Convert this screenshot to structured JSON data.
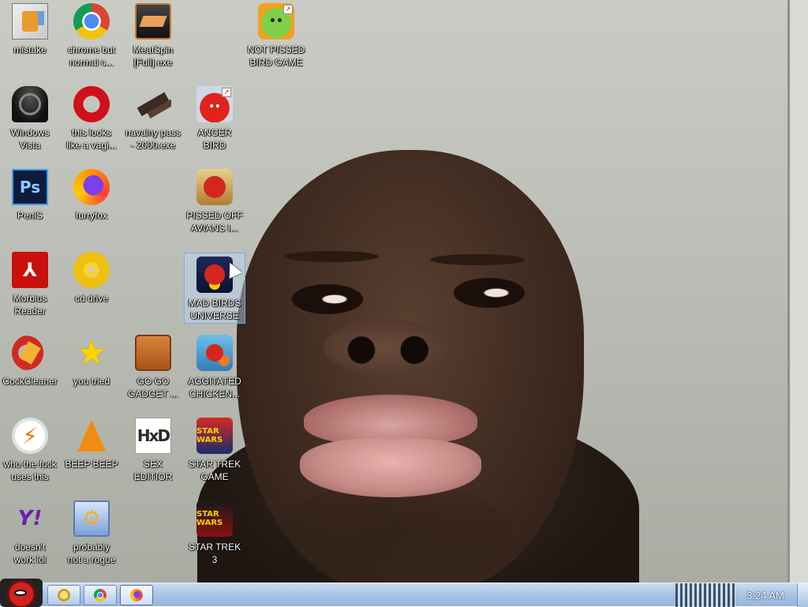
{
  "desktop": {
    "icons": [
      {
        "id": "mistake",
        "label": "mistake",
        "glyph": "g-mistake",
        "glyph_text": "",
        "icon": "installer-icon"
      },
      {
        "id": "chrome",
        "label": "chrome but\nnormal c...",
        "glyph": "g-chrome",
        "glyph_text": "",
        "icon": "chrome-icon"
      },
      {
        "id": "meatspin",
        "label": "MeatSpin\n[Full].exe",
        "glyph": "g-meat",
        "glyph_text": "",
        "icon": "app-icon"
      },
      {
        "id": "notpissed",
        "label": "NOT PISSED\nBIRD GAME",
        "glyph": "g-pig",
        "glyph_text": "",
        "icon": "green-pig-icon"
      },
      {
        "id": "vista",
        "label": "Windows\nVista",
        "glyph": "g-vista",
        "glyph_text": "",
        "icon": "trash-bin-icon"
      },
      {
        "id": "opera",
        "label": "this looks\nlike a vagi...",
        "glyph": "g-opera",
        "glyph_text": "",
        "icon": "opera-icon"
      },
      {
        "id": "navalny",
        "label": "navalny pass\n- 2000.exe",
        "glyph": "g-gun",
        "glyph_text": "",
        "icon": "pistol-icon"
      },
      {
        "id": "anger",
        "label": "ANGER\nBIRD",
        "glyph": "g-angry",
        "glyph_text": "",
        "icon": "red-bird-icon"
      },
      {
        "id": "penis",
        "label": "PeniS",
        "glyph": "g-ps",
        "glyph_text": "Ps",
        "icon": "photoshop-icon"
      },
      {
        "id": "furryfox",
        "label": "furryfox",
        "glyph": "g-ff",
        "glyph_text": "",
        "icon": "firefox-icon"
      },
      {
        "id": "avians",
        "label": "PISSED OFF\nAVIANS I...",
        "glyph": "g-seasons",
        "glyph_text": "",
        "icon": "bird-seasons-icon"
      },
      {
        "id": "morbius",
        "label": "Morbius\nReader",
        "glyph": "g-pdf",
        "glyph_text": "⅄",
        "icon": "pdf-reader-icon"
      },
      {
        "id": "cddrive",
        "label": "cd drive",
        "glyph": "g-cd",
        "glyph_text": "",
        "icon": "cd-icon"
      },
      {
        "id": "madbirds",
        "label": "MAD BIRDS\nUNIVERSE",
        "glyph": "g-space",
        "glyph_text": "",
        "icon": "bird-space-icon",
        "selected": true
      },
      {
        "id": "cockclean",
        "label": "CockCleaner",
        "glyph": "g-ccl",
        "glyph_text": "",
        "icon": "cleaner-icon"
      },
      {
        "id": "youtried",
        "label": "you tried",
        "glyph": "g-star",
        "glyph_text": "★",
        "icon": "star-icon"
      },
      {
        "id": "gadget",
        "label": "GO GO\nGADGET ...",
        "glyph": "g-case",
        "glyph_text": "",
        "icon": "briefcase-icon"
      },
      {
        "id": "chicken",
        "label": "AGGITATED\nCHICKEN...",
        "glyph": "g-chicken",
        "glyph_text": "",
        "icon": "bird-rio-icon"
      },
      {
        "id": "whofuck",
        "label": "who the fuck\nuses this",
        "glyph": "g-bolt",
        "glyph_text": "⚡",
        "icon": "lightning-icon"
      },
      {
        "id": "beepbeep",
        "label": "BEEP BEEP",
        "glyph": "g-vlc",
        "glyph_text": "",
        "icon": "traffic-cone-icon"
      },
      {
        "id": "sexedit",
        "label": "SEX\nEDITIOR",
        "glyph": "g-hxd",
        "glyph_text": "HxD",
        "icon": "hex-editor-icon"
      },
      {
        "id": "startrek",
        "label": "STAR TREK\nGAME",
        "glyph": "g-sw",
        "glyph_text": "STAR WARS",
        "icon": "bird-starwars-icon"
      },
      {
        "id": "yahoo",
        "label": "doesn't\nwork lol",
        "glyph": "g-yahoo",
        "glyph_text": "Y!",
        "icon": "yahoo-messenger-icon"
      },
      {
        "id": "rogue",
        "label": "probably\nnot a rogue",
        "glyph": "g-gears",
        "glyph_text": "",
        "icon": "control-panel-icon"
      },
      {
        "id": "startrek3",
        "label": "STAR TREK\n3",
        "glyph": "g-sw3",
        "glyph_text": "STAR WARS",
        "icon": "bird-starwars-2-icon"
      }
    ]
  },
  "taskbar": {
    "clock": "3:24 AM",
    "buttons": [
      {
        "id": "explorer",
        "icon": "folder-icon",
        "active": false
      },
      {
        "id": "chrome",
        "icon": "chrome-icon",
        "active": false
      },
      {
        "id": "firefox",
        "icon": "firefox-icon",
        "active": true
      }
    ]
  },
  "colors": {
    "taskbar": "#a8c3e4",
    "selection": "#bed7f5",
    "label_text": "#ffffff"
  }
}
